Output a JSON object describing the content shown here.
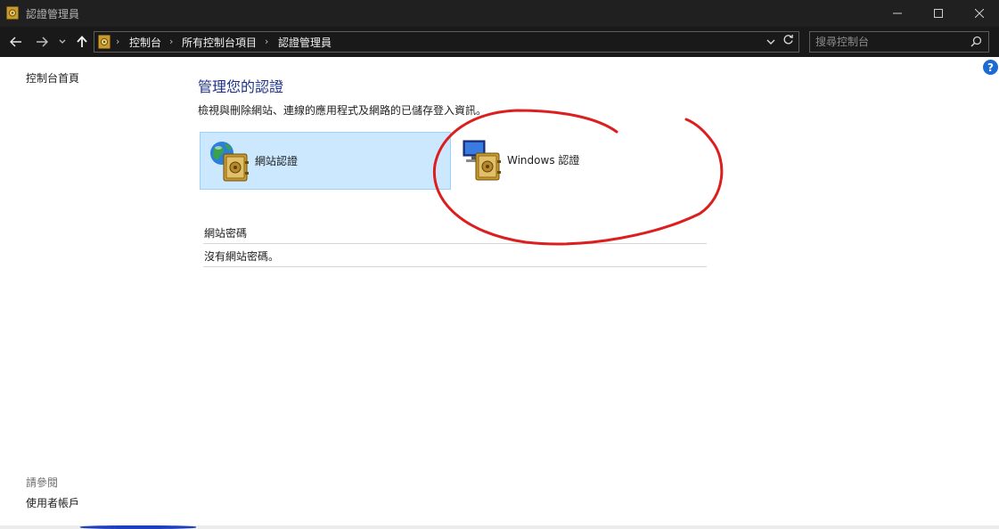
{
  "window": {
    "title": "認證管理員",
    "minimize_label": "—",
    "maximize_label": "☐",
    "close_label": "✕"
  },
  "nav": {
    "back": "←",
    "forward": "→",
    "recent": "⌄",
    "up": "↑"
  },
  "address": {
    "sep": "›",
    "breadcrumbs": [
      "控制台",
      "所有控制台項目",
      "認證管理員"
    ],
    "dropdown": "⌄",
    "refresh": "↻"
  },
  "search": {
    "placeholder": "搜尋控制台"
  },
  "left_nav": {
    "home": "控制台首頁",
    "see_also": "請參閱",
    "user_accounts": "使用者帳戶"
  },
  "main": {
    "title": "管理您的認證",
    "description": "檢視與刪除網站、連線的應用程式及網路的已儲存登入資訊。",
    "tiles": [
      {
        "label": "網站認證",
        "icon": "globe-vault-icon",
        "selected": true
      },
      {
        "label": "Windows 認證",
        "icon": "computer-vault-icon",
        "selected": false
      }
    ],
    "section_header": "網站密碼",
    "empty_message": "沒有網站密碼。"
  },
  "colors": {
    "titlebar": "#202020",
    "navbar": "#191919",
    "title_blue": "#1e3287",
    "tile_selected_bg": "#cce8ff",
    "annotation_red": "#dc1e1e"
  }
}
